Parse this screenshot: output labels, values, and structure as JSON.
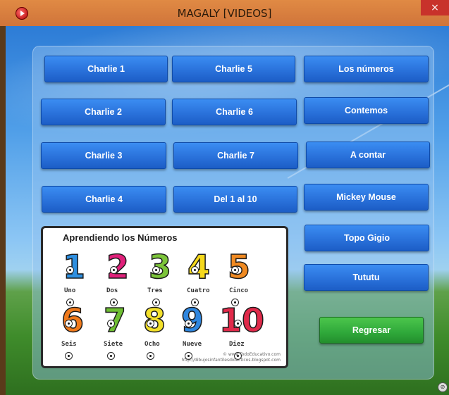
{
  "window": {
    "title": "MAGALY [VIDEOS]",
    "close_glyph": "×"
  },
  "buttons": {
    "col1": [
      "Charlie 1",
      "Charlie 2",
      "Charlie 3",
      "Charlie 4"
    ],
    "col2": [
      "Charlie 5",
      "Charlie 6",
      "Charlie 7",
      "Del 1 al 10"
    ],
    "col3": [
      "Los números",
      "Contemos",
      "A contar",
      "Mickey Mouse",
      "Topo Gigio",
      "Tututu"
    ],
    "back": "Regresar"
  },
  "card": {
    "title": "Aprendiendo los Números",
    "numbers": [
      {
        "n": "1",
        "word": "Uno",
        "color": "#2e8fe0"
      },
      {
        "n": "2",
        "word": "Dos",
        "color": "#e0207a"
      },
      {
        "n": "3",
        "word": "Tres",
        "color": "#7cc43a"
      },
      {
        "n": "4",
        "word": "Cuatro",
        "color": "#f5d81c"
      },
      {
        "n": "5",
        "word": "Cinco",
        "color": "#f08a22"
      },
      {
        "n": "6",
        "word": "Seis",
        "color": "#f07a1c"
      },
      {
        "n": "7",
        "word": "Siete",
        "color": "#6fbf33"
      },
      {
        "n": "8",
        "word": "Ocho",
        "color": "#f3e02a"
      },
      {
        "n": "9",
        "word": "Nueve",
        "color": "#2f86de"
      },
      {
        "n": "10",
        "word": "Diez",
        "color": "#e02a4a"
      }
    ],
    "credit_line1": "© www.TodoEducativo.com",
    "credit_line2": "http://dibujosinfantilesdidacticos.blogspot.com"
  },
  "icons": {
    "app": "play-icon",
    "close": "close-icon",
    "corner": "logo-icon"
  }
}
